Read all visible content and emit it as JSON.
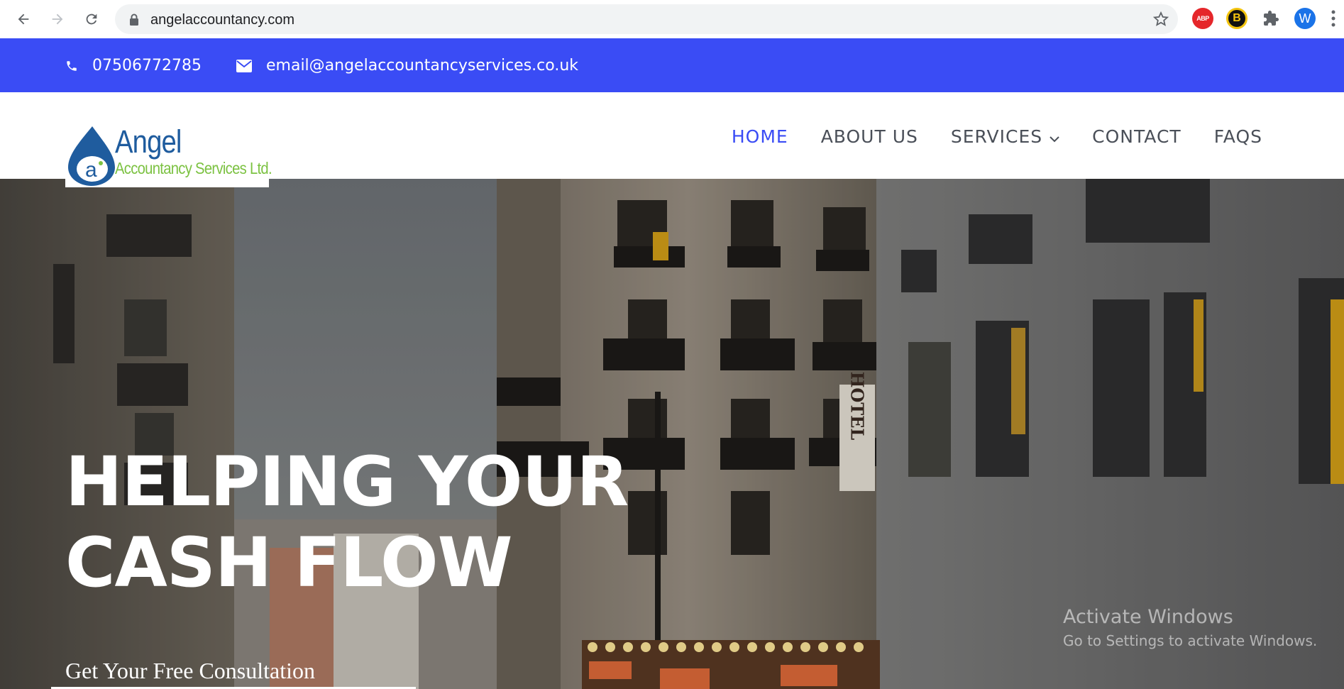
{
  "browser": {
    "url": "angelaccountancy.com",
    "avatar_letter": "W",
    "abp_label": "ABP",
    "b_label": "B"
  },
  "topbar": {
    "phone": "07506772785",
    "email": "email@angelaccountancyservices.co.uk",
    "bg_color": "#3a4cf5"
  },
  "logo": {
    "name_line1": "Angel",
    "name_line2": "Accountancy Services Ltd.",
    "mark_text": "a"
  },
  "menu": {
    "items": [
      {
        "label": "HOME",
        "active": true
      },
      {
        "label": "ABOUT US",
        "active": false
      },
      {
        "label": "SERVICES",
        "active": false,
        "has_dropdown": true
      },
      {
        "label": "CONTACT",
        "active": false
      },
      {
        "label": "FAQS",
        "active": false
      }
    ]
  },
  "hero": {
    "headline": "HELPING YOUR CASH FLOW",
    "cta": "Get Your Free Consultation",
    "sign_text": "HOTEL"
  },
  "watermark": {
    "title": "Activate Windows",
    "subtitle": "Go to Settings to activate Windows."
  }
}
